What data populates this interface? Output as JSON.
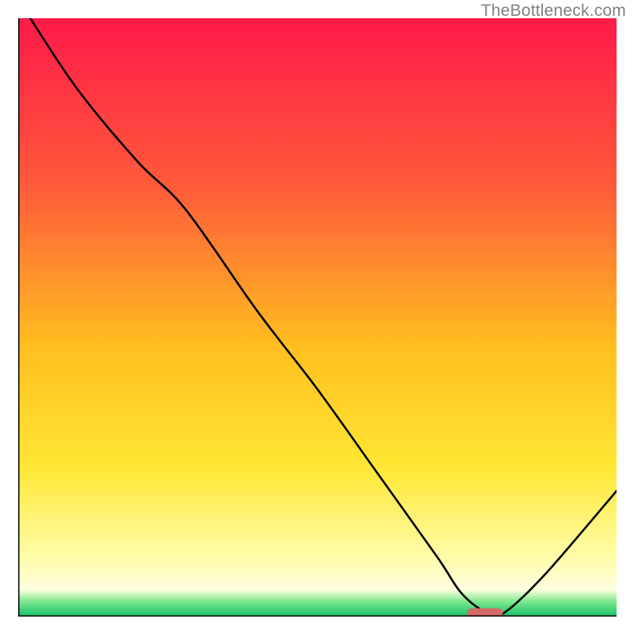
{
  "watermark": "TheBottleneck.com",
  "chart_data": {
    "type": "line",
    "title": "",
    "xlabel": "",
    "ylabel": "",
    "xlim": [
      0,
      100
    ],
    "ylim": [
      0,
      100
    ],
    "grid": false,
    "series": [
      {
        "name": "curve",
        "x": [
          2,
          10,
          20,
          28,
          40,
          50,
          60,
          70,
          74,
          78,
          81,
          88,
          100
        ],
        "y": [
          100,
          88,
          76,
          68,
          51,
          38,
          24,
          10,
          4,
          0.8,
          0.5,
          7,
          21
        ]
      }
    ],
    "marker": {
      "x_center": 78,
      "width": 6,
      "y": 0.6,
      "color": "#d36a6a"
    },
    "gradient_stops": [
      {
        "offset": 0,
        "color": "#ff1a49"
      },
      {
        "offset": 0.28,
        "color": "#ff5a3a"
      },
      {
        "offset": 0.55,
        "color": "#ffbf1f"
      },
      {
        "offset": 0.75,
        "color": "#ffe733"
      },
      {
        "offset": 0.9,
        "color": "#fffca8"
      },
      {
        "offset": 0.955,
        "color": "#ffffe0"
      },
      {
        "offset": 0.975,
        "color": "#7de88e"
      },
      {
        "offset": 1.0,
        "color": "#13c16a"
      }
    ],
    "axis_color": "#000000",
    "curve_color": "#000000"
  }
}
